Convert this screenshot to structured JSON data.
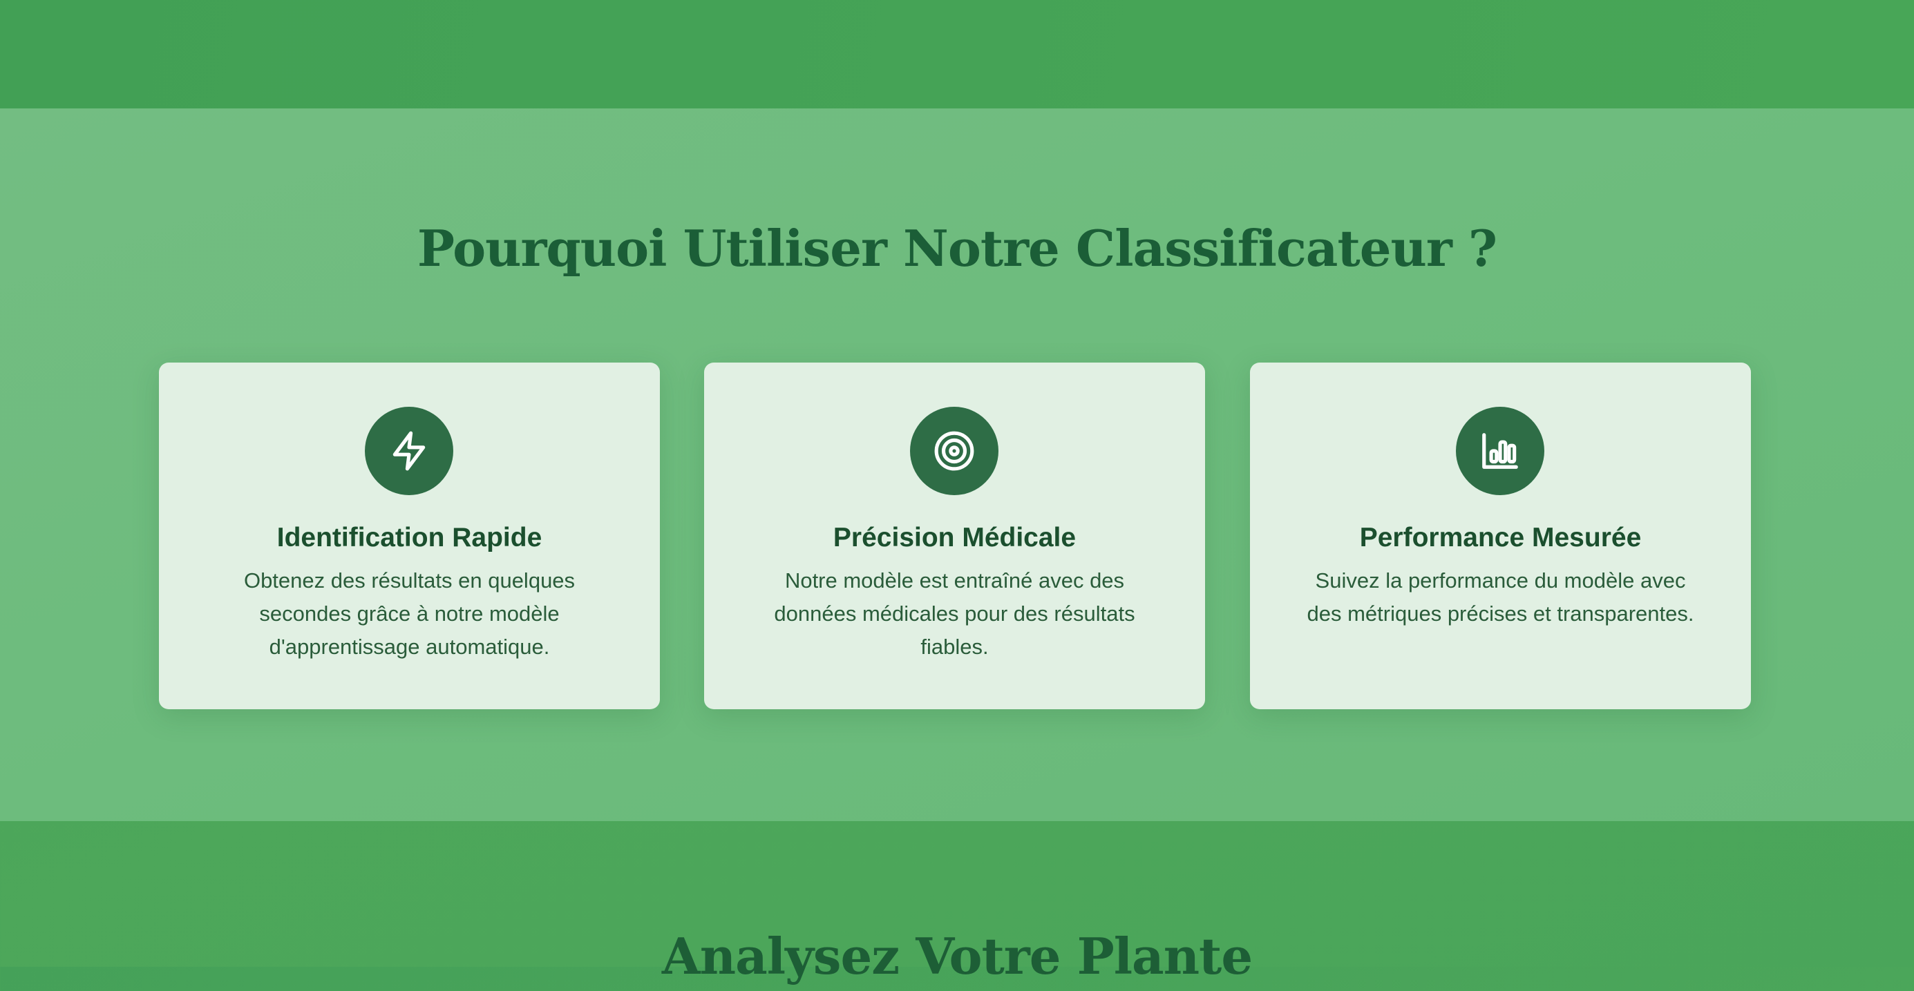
{
  "features": {
    "title": "Pourquoi Utiliser Notre Classificateur ?",
    "cards": [
      {
        "icon": "lightning-icon",
        "title": "Identification Rapide",
        "description": "Obtenez des résultats en quelques secondes grâce à notre modèle d'apprentissage automatique."
      },
      {
        "icon": "target-icon",
        "title": "Précision Médicale",
        "description": "Notre modèle est entraîné avec des données médicales pour des résultats fiables."
      },
      {
        "icon": "bar-chart-icon",
        "title": "Performance Mesurée",
        "description": "Suivez la performance du modèle avec des métriques précises et transparentes."
      }
    ]
  },
  "analyze": {
    "title": "Analysez Votre Plante"
  },
  "colors": {
    "page_green": "#4aa55a",
    "section_green": "#6dbc7d",
    "card_background": "#e1f0e3",
    "icon_circle": "#2e6d46",
    "heading": "#1b5e37"
  }
}
